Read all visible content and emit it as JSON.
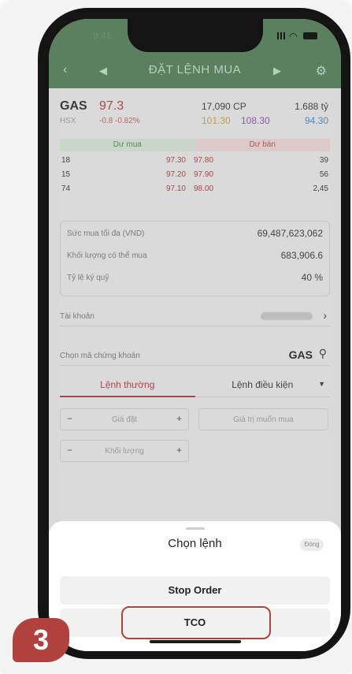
{
  "status": {
    "time": "9:41"
  },
  "nav": {
    "title": "ĐẶT LỆNH MUA"
  },
  "stock": {
    "symbol": "GAS",
    "exchange": "HSX",
    "price": "97.3",
    "change": "-0.8  -0.82%",
    "volume": "17,090  CP",
    "value": "1.688  tỷ",
    "ref": "101.30",
    "ceil": "108.30",
    "floor": "94.30"
  },
  "orderbook": {
    "buy_header": "Dư mua",
    "sell_header": "Dư bán",
    "rows": [
      {
        "buy_qty": "18",
        "buy_price": "97.30",
        "sell_price": "97.80",
        "sell_qty": "39"
      },
      {
        "buy_qty": "15",
        "buy_price": "97.20",
        "sell_price": "97.90",
        "sell_qty": "56"
      },
      {
        "buy_qty": "74",
        "buy_price": "97.10",
        "sell_price": "98.00",
        "sell_qty": "2,45"
      }
    ]
  },
  "info": {
    "rows": [
      {
        "label": "Sức mua tối đa (VND)",
        "value": "69,487,623,062"
      },
      {
        "label": "Khối lượng có thể mua",
        "value": "683,906.6"
      },
      {
        "label": "Tỷ lệ ký quỹ",
        "value": "40 %"
      }
    ]
  },
  "account": {
    "label": "Tài khoản"
  },
  "symbol_pick": {
    "label": "Chọn mã chứng khoán",
    "value": "GAS"
  },
  "order_tabs": {
    "normal": "Lệnh thường",
    "conditional": "Lệnh điều kiện"
  },
  "fields": {
    "price": "Giá đặt",
    "quantity": "Khối lượng",
    "value": "Giá trị muốn mua"
  },
  "sheet": {
    "title": "Chọn lệnh",
    "close": "Đóng",
    "options": [
      "Stop Order",
      "TCO"
    ]
  },
  "badge": {
    "step": "3"
  },
  "colors": {
    "accent": "#b0413d",
    "header": "#5a8060"
  }
}
